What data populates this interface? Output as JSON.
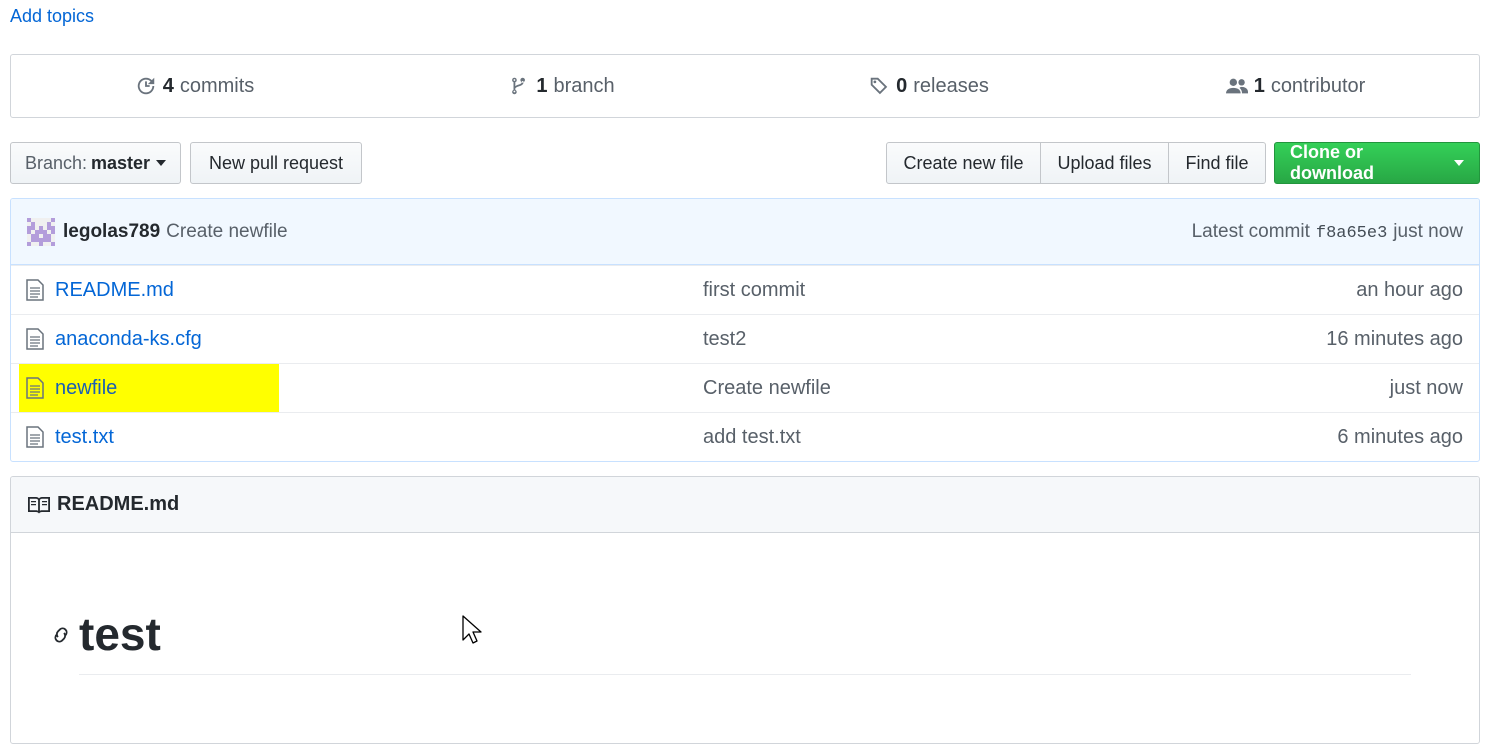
{
  "topics_link": "Add topics",
  "summary": {
    "commits": {
      "count": "4",
      "label": "commits",
      "icon": "history-icon"
    },
    "branches": {
      "count": "1",
      "label": "branch",
      "icon": "git-branch-icon"
    },
    "releases": {
      "count": "0",
      "label": "releases",
      "icon": "tag-icon"
    },
    "contributors": {
      "count": "1",
      "label": "contributor",
      "icon": "people-icon"
    }
  },
  "toolbar": {
    "branch_prefix": "Branch:",
    "branch_name": "master",
    "new_pull_request": "New pull request",
    "create_new_file": "Create new file",
    "upload_files": "Upload files",
    "find_file": "Find file",
    "clone_or_download": "Clone or download"
  },
  "latest_commit": {
    "author": "legolas789",
    "message": "Create newfile",
    "prefix": "Latest commit",
    "sha": "f8a65e3",
    "time": "just now"
  },
  "files": [
    {
      "name": "README.md",
      "message": "first commit",
      "age": "an hour ago"
    },
    {
      "name": "anaconda-ks.cfg",
      "message": "test2",
      "age": "16 minutes ago"
    },
    {
      "name": "newfile",
      "message": "Create newfile",
      "age": "just now",
      "highlighted": true
    },
    {
      "name": "test.txt",
      "message": "add test.txt",
      "age": "6 minutes ago"
    }
  ],
  "readme": {
    "title": "README.md",
    "heading": "test"
  },
  "colors": {
    "link": "#0366d6",
    "clone_green": "#28a745",
    "highlight": "#ffff00",
    "commit_bar_bg": "#f1f8ff"
  }
}
